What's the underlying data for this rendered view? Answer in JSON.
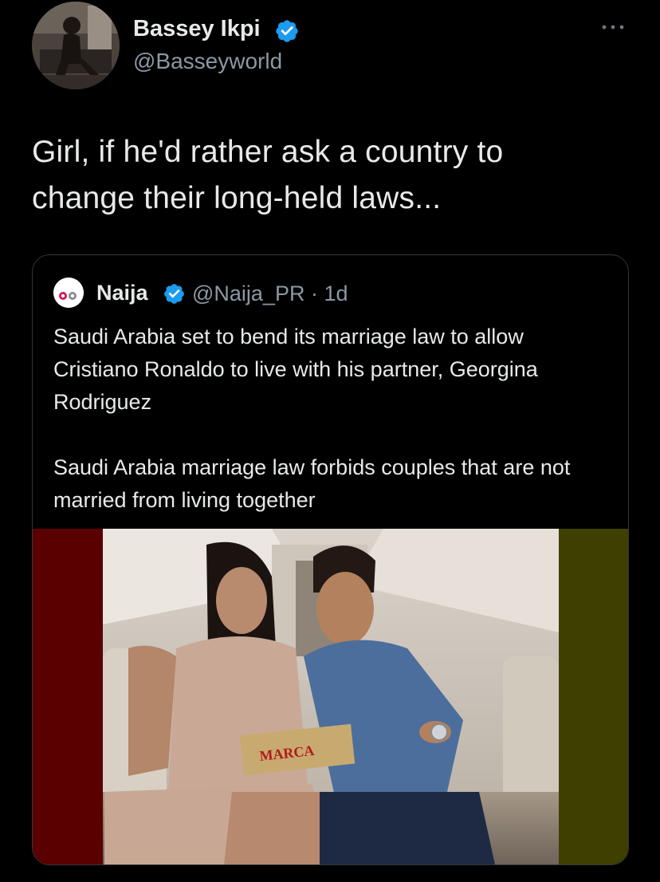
{
  "author": {
    "name": "Bassey Ikpi",
    "handle": "@Basseyworld",
    "verified": true
  },
  "tweet": {
    "text_line1": "Girl, if he'd rather ask a country to",
    "text_line2": "change their long-held laws..."
  },
  "quoted_tweet": {
    "name": "Naija",
    "verified": true,
    "handle_time": "@Naija_PR · 1d",
    "paragraph1": "Saudi Arabia set to bend its marriage law to allow Cristiano Ronaldo to live with his partner, Georgina Rodriguez",
    "paragraph2": "Saudi Arabia marriage law forbids couples that are not married from living together"
  },
  "media": {
    "box_label": "MARCA"
  },
  "colors": {
    "background": "#000000",
    "text": "#e7e9ea",
    "secondary_text": "#8b98a5",
    "verified_badge": "#1d9bf0",
    "border": "#333639",
    "media_left_panel": "#5a0000",
    "media_right_panel": "#3f3f00"
  },
  "icons": {
    "verified": "verified-badge-icon",
    "more": "more-options-icon"
  }
}
